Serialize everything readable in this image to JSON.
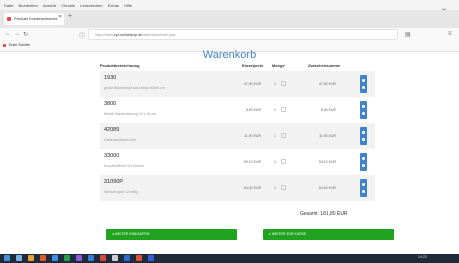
{
  "browser": {
    "menu": [
      "Datei",
      "Bearbeiten",
      "Ansicht",
      "Chronik",
      "Lesezeichen",
      "Extras",
      "Hilfe"
    ],
    "tab_label": "Produkt Sonderwünsche",
    "url_prefix": "https://www.",
    "url_host": "xyz-onlineshop.de",
    "url_path": "/warenkorb/index.php",
    "bookmark": "Erste Schritte"
  },
  "page": {
    "title": "Warenkorb",
    "headers": {
      "product": "Produktbezeichnung",
      "unit_price": "Einzelpreis",
      "quantity": "Menge",
      "subtotal": "Zwischensumme"
    },
    "items": [
      {
        "code": "1930",
        "desc": "große Blumentopf aus Metall 40x40 cm",
        "unit": "47,90 EUR",
        "qty": "1",
        "sub": "47,90 EUR"
      },
      {
        "code": "3800",
        "desc": "Metall Wandhalterung 20 x 15 cm",
        "unit": "8,90 EUR",
        "qty": "1",
        "sub": "8,90 EUR"
      },
      {
        "code": "42089",
        "desc": "Gartenschlauch 20m",
        "unit": "11,90 EUR",
        "qty": "1",
        "sub": "11,90 EUR"
      },
      {
        "code": "33000",
        "desc": "Kunststoffkorb mit Deckel",
        "unit": "59,10 EUR",
        "qty": "1",
        "sub": "59,10 EUR"
      },
      {
        "code": "31090P",
        "desc": "Werkzeugset 12-teilig",
        "unit": "54,00 EUR",
        "qty": "1",
        "sub": "54,00 EUR"
      }
    ],
    "total_label": "Gesamt:",
    "total_value": "181,80 EUR",
    "continue_btn": "WEITER EINKAUFEN",
    "checkout_btn": "WEITER ZUR KASSE"
  },
  "taskbar": {
    "clock": "14:23"
  },
  "colors": {
    "accent": "#3f84c6",
    "green": "#20a320",
    "taskbar": "#1d2b3a"
  }
}
